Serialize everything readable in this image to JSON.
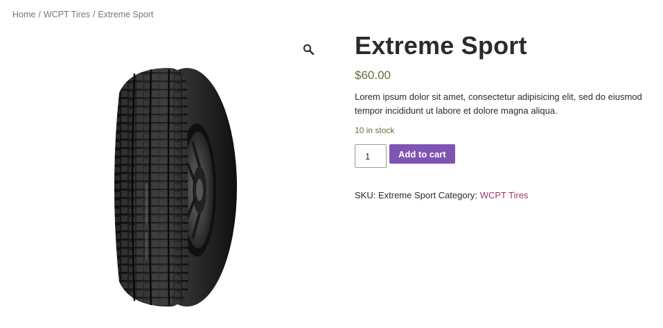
{
  "breadcrumb": {
    "items": [
      "Home",
      "WCPT Tires",
      "Extreme Sport"
    ],
    "separator": "/"
  },
  "gallery": {
    "zoom_icon": "magnifier-icon",
    "image_alt": "tire"
  },
  "product": {
    "title": "Extreme Sport",
    "price": "$60.00",
    "description_line1": "Lorem ipsum dolor sit amet, consectetur adipisicing elit, sed do eiusmod",
    "description_line2": "tempor incididunt ut labore et dolore magna aliqua.",
    "stock": "10 in stock",
    "quantity": "1",
    "add_to_cart_label": "Add to cart",
    "sku_label": "SKU:",
    "sku_value": "Extreme Sport",
    "category_label": "Category:",
    "category_value": "WCPT Tires"
  },
  "colors": {
    "button_bg": "#7f54b3",
    "price": "#6b6b3a",
    "link": "#a0366a"
  }
}
